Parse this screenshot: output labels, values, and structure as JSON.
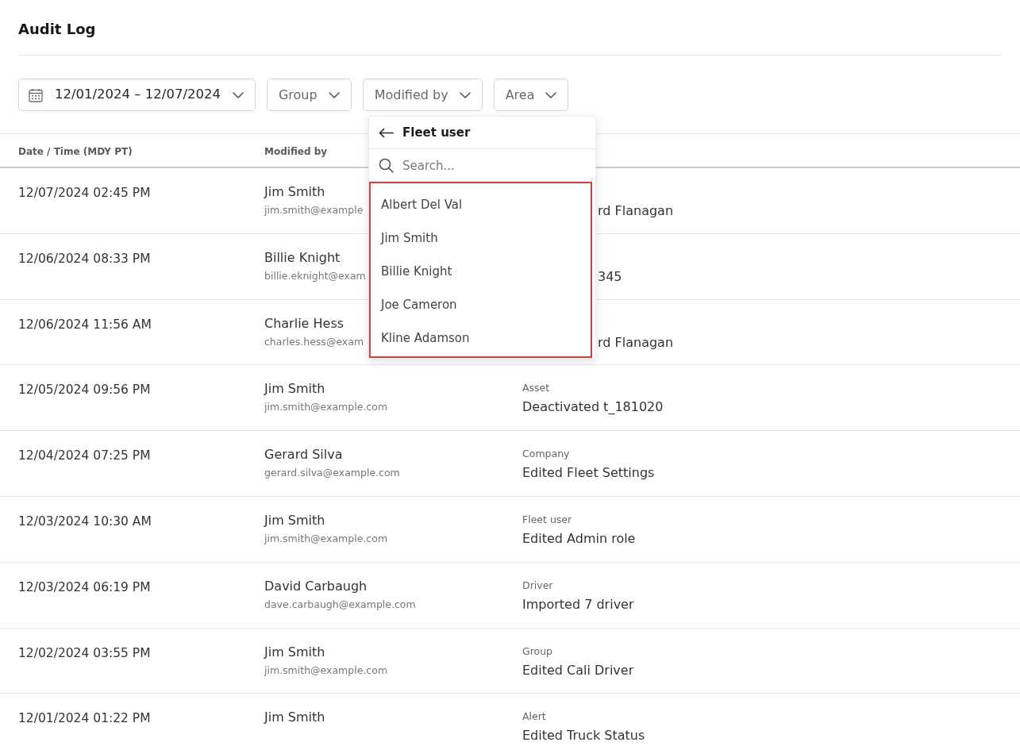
{
  "page": {
    "title": "Audit Log"
  },
  "filters": [
    {
      "kind": "date",
      "label": "12/01/2024 – 12/07/2024"
    },
    {
      "kind": "select",
      "label": "Group"
    },
    {
      "kind": "select",
      "label": "Modified by"
    },
    {
      "kind": "select",
      "label": "Area"
    }
  ],
  "table": {
    "columns": [
      "Date / Time (MDY PT)",
      "Modified by"
    ],
    "rows": [
      {
        "kind": "covered",
        "datetime": "12/07/2024 02:45 PM",
        "name": "Jim Smith",
        "email": "jim.smith@example",
        "activity": "rd Flanagan"
      },
      {
        "kind": "covered",
        "datetime": "12/06/2024 08:33 PM",
        "name": "Billie Knight",
        "email": "billie.eknight@exam",
        "activity": "345"
      },
      {
        "kind": "covered",
        "datetime": "12/06/2024 11:56 AM",
        "name": "Charlie Hess",
        "email": "charles.hess@exam",
        "activity": "rd Flanagan"
      },
      {
        "kind": "full",
        "datetime": "12/05/2024 09:56 PM",
        "name": "Jim Smith",
        "email": "jim.smith@example.com",
        "area": "Asset",
        "activity": "Deactivated t_181020"
      },
      {
        "kind": "full",
        "datetime": "12/04/2024 07:25 PM",
        "name": "Gerard Silva",
        "email": "gerard.silva@example.com",
        "area": "Company",
        "activity": "Edited Fleet Settings"
      },
      {
        "kind": "full",
        "datetime": "12/03/2024 10:30 AM",
        "name": "Jim Smith",
        "email": "jim.smith@example.com",
        "area": "Fleet user",
        "activity": "Edited Admin role"
      },
      {
        "kind": "full",
        "datetime": "12/03/2024 06:19 PM",
        "name": "David Carbaugh",
        "email": "dave.carbaugh@example.com",
        "area": "Driver",
        "activity": "Imported 7 driver"
      },
      {
        "kind": "full",
        "datetime": "12/02/2024 03:55 PM",
        "name": "Jim Smith",
        "email": "jim.smith@example.com",
        "area": "Group",
        "activity": "Edited Cali Driver"
      },
      {
        "kind": "full",
        "datetime": "12/01/2024 01:22 PM",
        "name": "Jim Smith",
        "area": "Alert",
        "activity": "Edited Truck Status"
      }
    ]
  },
  "dropdown": {
    "title": "Fleet user",
    "search": {
      "placeholder": "Search..."
    },
    "options": [
      "Albert Del Val",
      "Jim Smith",
      "Billie Knight",
      "Joe Cameron",
      "Kline Adamson"
    ]
  }
}
